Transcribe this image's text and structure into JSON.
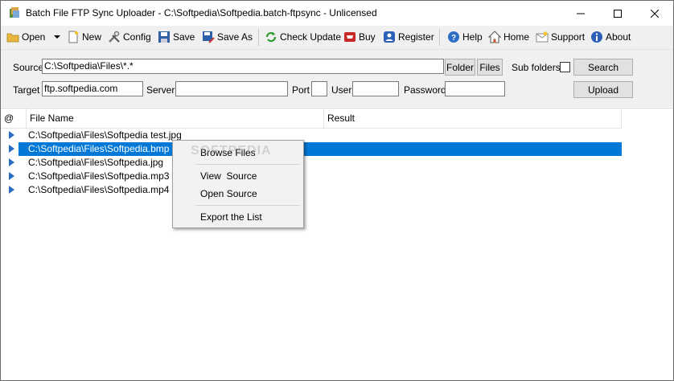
{
  "window": {
    "title": "Batch File FTP Sync Uploader - C:\\Softpedia\\Softpedia.batch-ftpsync - Unlicensed",
    "minimize_glyph": "—",
    "maximize_glyph": "☐",
    "close_glyph": "✕"
  },
  "toolbar": {
    "open": "Open",
    "new": "New",
    "config": "Config",
    "save": "Save",
    "save_as": "Save As",
    "check_update": "Check Update",
    "buy": "Buy",
    "register": "Register",
    "help": "Help",
    "home": "Home",
    "support": "Support",
    "about": "About"
  },
  "form": {
    "source_label": "Source",
    "source_value": "C:\\Softpedia\\Files\\*.*",
    "folder_button": "Folder",
    "files_button": "Files",
    "subfolders_label": "Sub folders",
    "subfolders_checked": false,
    "search_button": "Search",
    "target_label": "Target",
    "target_value": "ftp.softpedia.com",
    "server_label": "Server",
    "server_value": "",
    "port_label": "Port",
    "port_value": "",
    "user_label": "User",
    "user_value": "",
    "password_label": "Password",
    "password_value": "",
    "upload_button": "Upload"
  },
  "list": {
    "columns": [
      "@",
      "File Name",
      "Result"
    ],
    "rows": [
      {
        "file": "C:\\Softpedia\\Files\\Softpedia test.jpg",
        "result": "",
        "selected": false
      },
      {
        "file": "C:\\Softpedia\\Files\\Softpedia.bmp",
        "result": "",
        "selected": true
      },
      {
        "file": "C:\\Softpedia\\Files\\Softpedia.jpg",
        "result": "",
        "selected": false
      },
      {
        "file": "C:\\Softpedia\\Files\\Softpedia.mp3",
        "result": "",
        "selected": false
      },
      {
        "file": "C:\\Softpedia\\Files\\Softpedia.mp4",
        "result": "",
        "selected": false
      }
    ]
  },
  "context_menu": {
    "items": [
      "Browse Files",
      "View  Source",
      "Open Source",
      "Export the List"
    ]
  },
  "watermark": "SOFTPEDIA",
  "colors": {
    "selection": "#0078d7",
    "toolbar_bg": "#f0f0f0",
    "row_arrow": "#2a6cc4"
  }
}
